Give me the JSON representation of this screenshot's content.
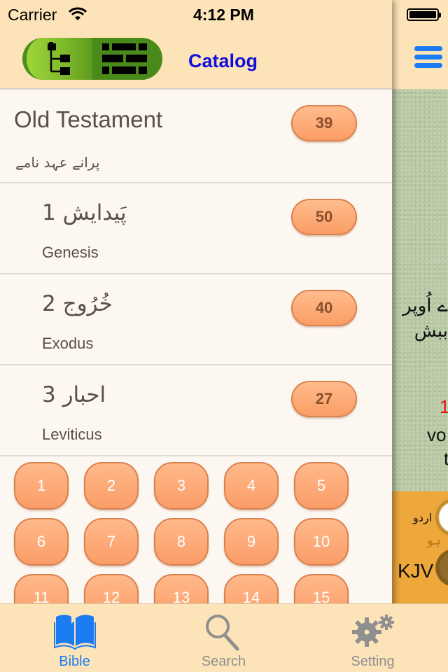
{
  "status_bar": {
    "carrier": "Carrier",
    "time": "4:12 PM"
  },
  "nav": {
    "title": "Catalog",
    "segments": [
      {
        "name": "tree-view",
        "icon": "tree-icon",
        "selected": true
      },
      {
        "name": "grid-view",
        "icon": "grid-icon",
        "selected": false
      }
    ]
  },
  "testament": {
    "title": "Old Testament",
    "subtitle": "پرانے عہد نامے",
    "count": "39"
  },
  "books": [
    {
      "title": "1 پَیدایش",
      "subtitle": "Genesis",
      "count": "50"
    },
    {
      "title": "2 خُرُوج",
      "subtitle": "Exodus",
      "count": "40"
    },
    {
      "title": "3 احبار",
      "subtitle": "Leviticus",
      "count": "27"
    }
  ],
  "chapters": [
    "1",
    "2",
    "3",
    "4",
    "5",
    "6",
    "7",
    "8",
    "9",
    "10",
    "11",
    "12",
    "13",
    "14",
    "15"
  ],
  "side_panel": {
    "urdu_line_1": "ے اُوپر",
    "urdu_line_2": "ببش",
    "red_number": "1",
    "text_line_1": "vo",
    "text_line_2": "t",
    "language_urdu": "اردو",
    "language_urdu_faded": "ہو",
    "language_kjv": "KJV"
  },
  "tabs": [
    {
      "label": "Bible",
      "icon": "book-icon",
      "active": true
    },
    {
      "label": "Search",
      "icon": "search-icon",
      "active": false
    },
    {
      "label": "Setting",
      "icon": "gear-icon",
      "active": false
    }
  ],
  "colors": {
    "accent_blue": "#1a7bf2",
    "title_blue": "#1010d8",
    "badge_orange": "#fb9d65",
    "header_bg": "#fde4b8",
    "segment_green": "#7cb82a"
  }
}
